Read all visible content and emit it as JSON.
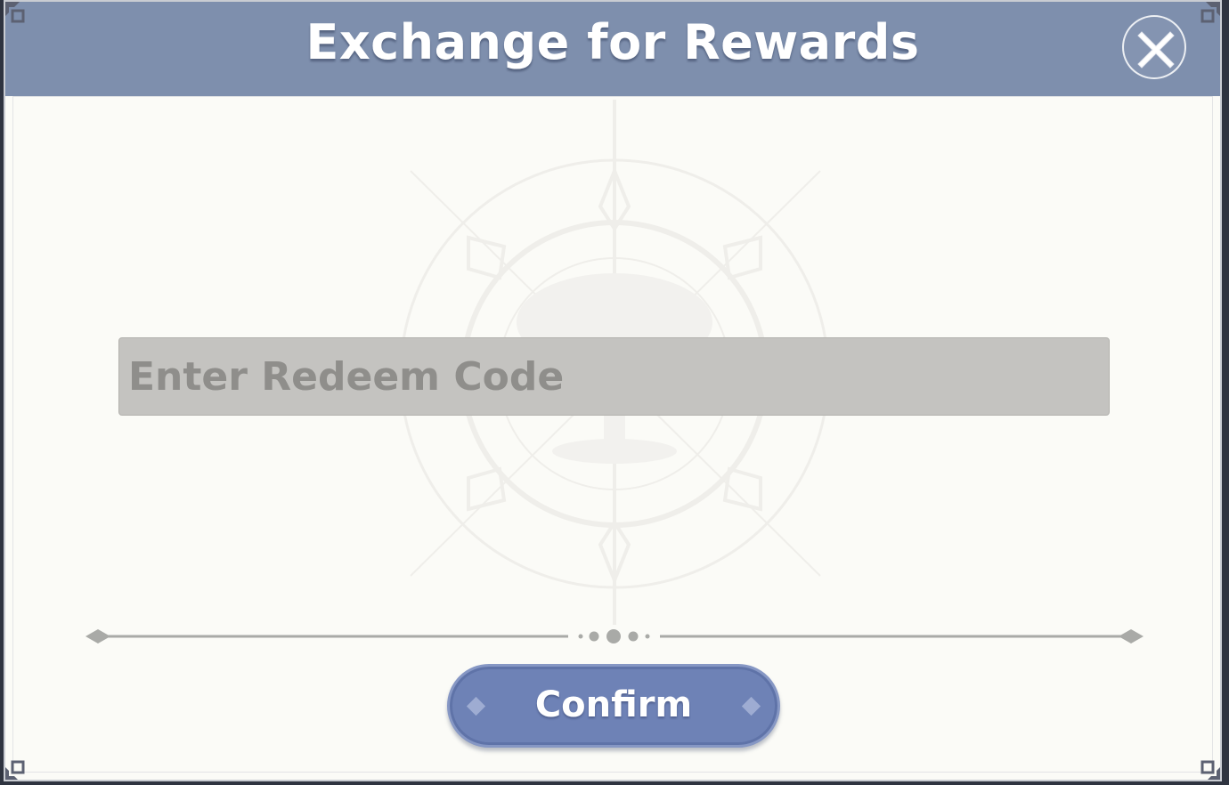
{
  "dialog": {
    "title": "Exchange for Rewards",
    "close_icon": "close-x-icon"
  },
  "redeem": {
    "placeholder": "Enter Redeem Code",
    "value": ""
  },
  "actions": {
    "confirm_label": "Confirm"
  },
  "theme": {
    "header_color": "#7e8fad",
    "panel_color": "#fbfbf7",
    "input_color": "#c4c3c0",
    "button_color": "#6e82b6",
    "divider_color": "#a9aaa7"
  },
  "icons": {
    "corner": "ornate-corner-icon",
    "watermark": "tree-compass-emblem-icon",
    "divider": "ornamental-divider"
  }
}
